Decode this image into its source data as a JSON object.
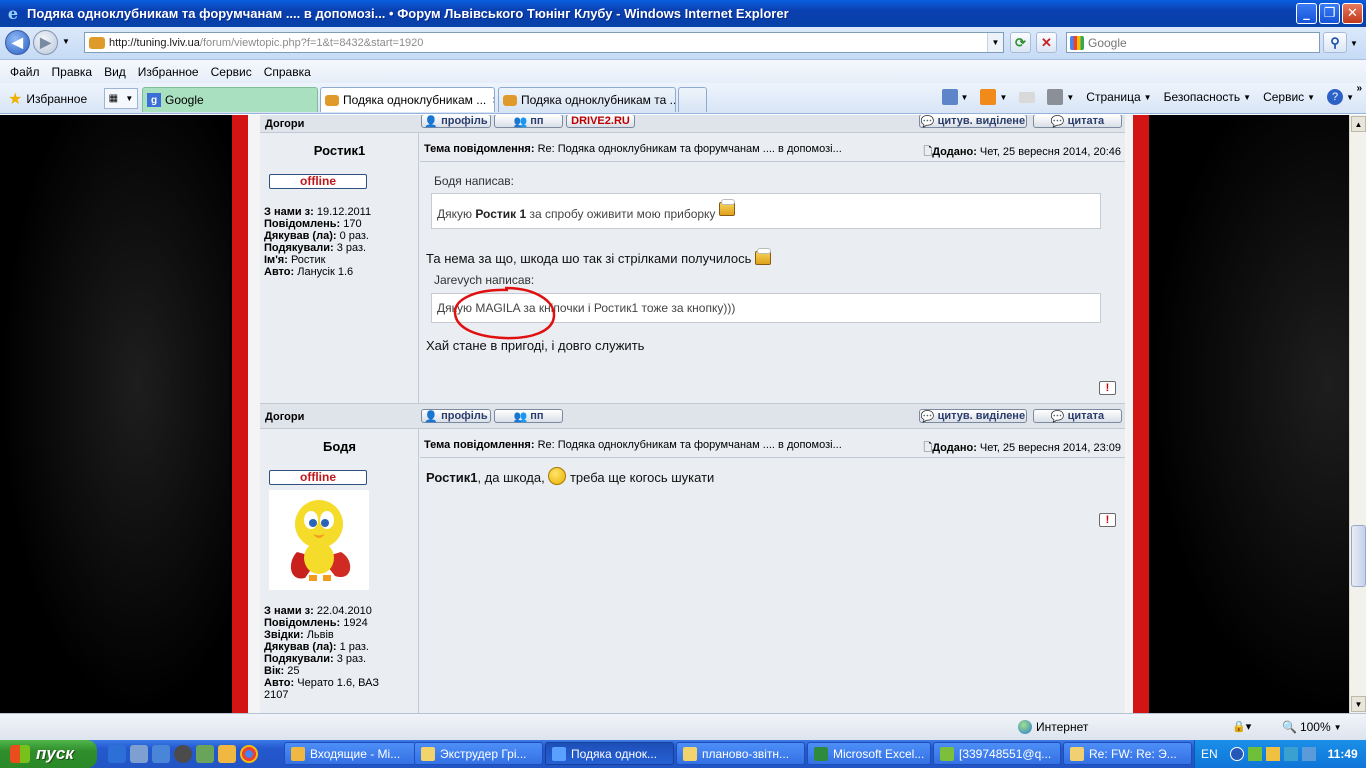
{
  "window": {
    "title": "Подяка одноклубникам та форумчанам .... в допомозі... • Форум Львівського Тюнінг Клубу - Windows Internet Explorer",
    "controls": {
      "minimize": "_",
      "restore": "❐",
      "close": "✕"
    }
  },
  "address": {
    "url_host": "http://tuning.lviv.ua",
    "url_path": "/forum/viewtopic.php?f=1&t=8432&start=1920",
    "search_placeholder": "Google"
  },
  "menu": [
    "Файл",
    "Правка",
    "Вид",
    "Избранное",
    "Сервис",
    "Справка"
  ],
  "favbar": {
    "favorites_label": "Избранное",
    "tabs": [
      {
        "label": "Google",
        "type": "google"
      },
      {
        "label": "Подяка одноклубникам ...",
        "type": "active"
      },
      {
        "label": "Подяка одноклубникам та ...",
        "type": "normal"
      }
    ],
    "commands": [
      "Страница",
      "Безопасность",
      "Сервис"
    ]
  },
  "forum": {
    "buttons": {
      "profile": "профіль",
      "pm": "пп",
      "drive2": "DRIVE2.RU",
      "quote_selected": "цитув. виділене",
      "quote": "цитата",
      "report": "!"
    },
    "uptop_label": "Догори",
    "topic_label": "Тема повідомлення:",
    "topic": "Re: Подяка одноклубникам та форумчанам .... в допомозі...",
    "added_label": "Додано:",
    "posts": [
      {
        "author": "Ростик1",
        "status": "offline",
        "date": "Чет, 25 вересня 2014, 20:46",
        "stats": [
          {
            "k": "З нами з:",
            "v": "19.12.2011"
          },
          {
            "k": "Повідомлень:",
            "v": "170"
          },
          {
            "k": "Дякував (ла):",
            "v": "0 раз."
          },
          {
            "k": "Подякували:",
            "v": "3 раз."
          },
          {
            "k": "Ім'я:",
            "v": "Ростик"
          },
          {
            "k": "Авто:",
            "v": "Ланусік 1.6"
          }
        ],
        "quote1_head": "Бодя написав:",
        "quote1_pre": "Дякую ",
        "quote1_bold": "Ростик 1",
        "quote1_post": " за спробу оживити мою приборку",
        "reply1": "Та нема за що, шкода шо так зі стрілками получилось",
        "quote2_head": "Jarevych написав:",
        "quote2_text": "Дякую MAGILA за кніпочки і Ростик1 тоже за кнопку)))",
        "reply2": "Хай стане в пригоді, і довго служить"
      },
      {
        "author": "Бодя",
        "status": "offline",
        "date": "Чет, 25 вересня 2014, 23:09",
        "stats": [
          {
            "k": "З нами з:",
            "v": "22.04.2010"
          },
          {
            "k": "Повідомлень:",
            "v": "1924"
          },
          {
            "k": "Звідки:",
            "v": "Львів"
          },
          {
            "k": "Дякував (ла):",
            "v": "1 раз."
          },
          {
            "k": "Подякували:",
            "v": "3 раз."
          },
          {
            "k": "Вік:",
            "v": "25"
          },
          {
            "k": "Авто:",
            "v": "Черато 1.6, ВАЗ"
          },
          {
            "k": "",
            "v": "2107"
          }
        ],
        "text_bold": "Ростик1",
        "text_a": ", да шкода, ",
        "text_b": " треба ще когось шукати"
      }
    ]
  },
  "statusbar": {
    "zone": "Интернет",
    "zoom": "100%"
  },
  "taskbar": {
    "start": "пуск",
    "items": [
      "Входящие - Mi...",
      "Экструдер Грі...",
      "Подяка однок...",
      "планово-звітн...",
      "Microsoft Excel...",
      "[339748551@q...",
      "Re: FW: Re: Э..."
    ],
    "lang": "EN",
    "clock": "11:49"
  },
  "colors": {
    "red_border": "#d21414",
    "forum_bg": "#eaedf2",
    "offline_text": "#c0171b",
    "annotation": "#e01010"
  }
}
